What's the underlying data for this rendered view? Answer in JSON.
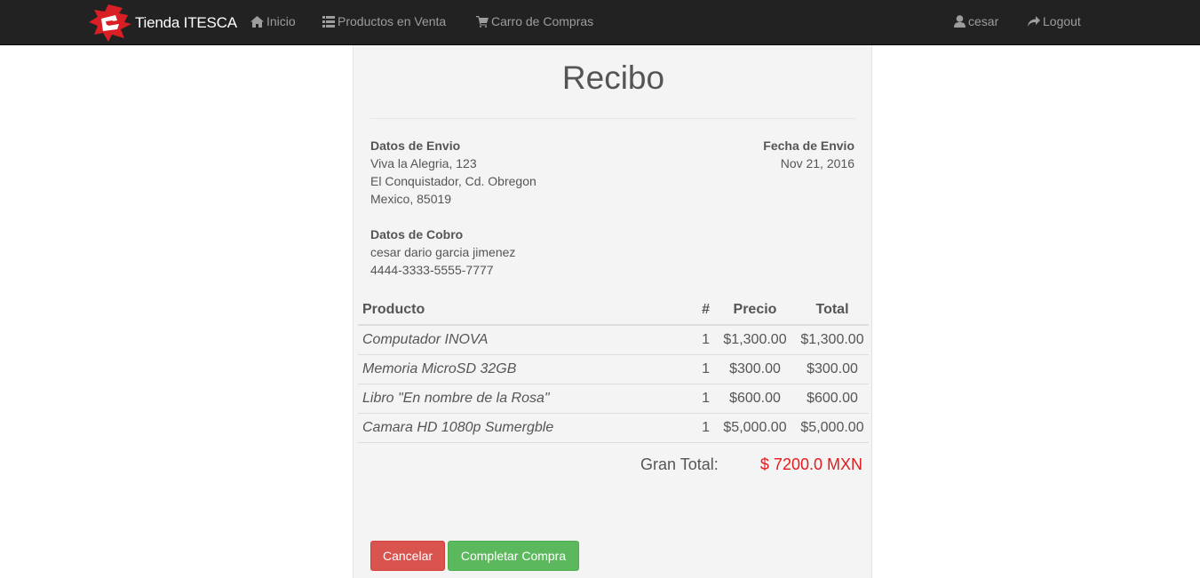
{
  "navbar": {
    "brand": "Tienda ITESCA",
    "links": [
      {
        "label": "Inicio",
        "icon": "home-icon"
      },
      {
        "label": "Productos en Venta",
        "icon": "list-icon"
      },
      {
        "label": "Carro de Compras",
        "icon": "cart-icon"
      }
    ],
    "user": {
      "label": "cesar",
      "icon": "user-icon"
    },
    "logout": {
      "label": "Logout",
      "icon": "share-arrow-icon"
    }
  },
  "receipt": {
    "title": "Recibo",
    "shipping": {
      "heading": "Datos de Envio",
      "line1": "Viva la Alegria, 123",
      "line2": "El Conquistador, Cd. Obregon",
      "line3": "Mexico, 85019"
    },
    "ship_date": {
      "heading": "Fecha de Envio",
      "value": "Nov 21, 2016"
    },
    "billing": {
      "heading": "Datos de Cobro",
      "name": "cesar dario garcia jimenez",
      "card": "4444-3333-5555-7777"
    },
    "table": {
      "headers": {
        "product": "Producto",
        "qty": "#",
        "price": "Precio",
        "total": "Total"
      },
      "rows": [
        {
          "product": "Computador INOVA",
          "qty": "1",
          "price": "$1,300.00",
          "total": "$1,300.00"
        },
        {
          "product": "Memoria MicroSD 32GB",
          "qty": "1",
          "price": "$300.00",
          "total": "$300.00"
        },
        {
          "product": "Libro \"En nombre de la Rosa\"",
          "qty": "1",
          "price": "$600.00",
          "total": "$600.00"
        },
        {
          "product": "Camara HD 1080p Sumergble",
          "qty": "1",
          "price": "$5,000.00",
          "total": "$5,000.00"
        }
      ]
    },
    "grand_total": {
      "label": "Gran Total:",
      "value": "$ 7200.0 MXN"
    },
    "buttons": {
      "cancel": "Cancelar",
      "complete": "Completar Compra"
    }
  },
  "colors": {
    "navbar_bg": "#222222",
    "panel_bg": "#f4f4f4",
    "danger": "#d9534f",
    "success": "#5cb85c",
    "total_red": "#e31b1b"
  }
}
